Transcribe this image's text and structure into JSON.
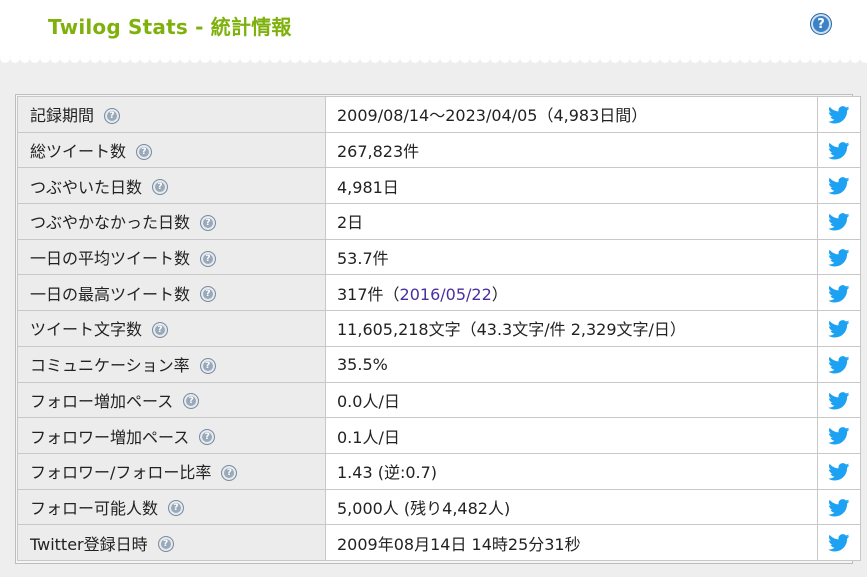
{
  "header": {
    "title": "Twilog Stats - 統計情報",
    "help_label": "?"
  },
  "colors": {
    "title_green": "#7fb10c",
    "twitter_blue": "#1da1f2",
    "link_purple": "#4b2ea0"
  },
  "icons": {
    "help": "question-circle-icon",
    "row_help": "question-circle-icon",
    "share": "twitter-bird-icon"
  },
  "rows": [
    {
      "label": "記録期間",
      "value": "2009/08/14〜2023/04/05（4,983日間）"
    },
    {
      "label": "総ツイート数",
      "value": "267,823件"
    },
    {
      "label": "つぶやいた日数",
      "value": "4,981日"
    },
    {
      "label": "つぶやかなかった日数",
      "value": "2日"
    },
    {
      "label": "一日の平均ツイート数",
      "value": "53.7件"
    },
    {
      "label": "一日の最高ツイート数",
      "value_prefix": "317件（",
      "value_link": "2016/05/22",
      "value_suffix": "）"
    },
    {
      "label": "ツイート文字数",
      "value": "11,605,218文字（43.3文字/件 2,329文字/日）"
    },
    {
      "label": "コミュニケーション率",
      "value": "35.5%"
    },
    {
      "label": "フォロー増加ペース",
      "value": "0.0人/日"
    },
    {
      "label": "フォロワー増加ペース",
      "value": "0.1人/日"
    },
    {
      "label": "フォロワー/フォロー比率",
      "value": "1.43 (逆:0.7)"
    },
    {
      "label": "フォロー可能人数",
      "value": "5,000人 (残り4,482人)"
    },
    {
      "label": "Twitter登録日時",
      "value": "2009年08月14日 14時25分31秒"
    }
  ]
}
